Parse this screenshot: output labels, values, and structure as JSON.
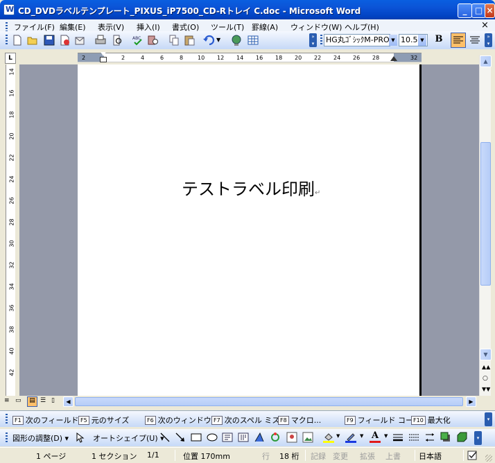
{
  "window": {
    "title": "CD_DVDラベルテンプレート_PIXUS_iP7500_CD-Rトレイ C.doc - Microsoft Word"
  },
  "menu": {
    "items": [
      "ファイル(F)",
      "編集(E)",
      "表示(V)",
      "挿入(I)",
      "書式(O)",
      "ツール(T)",
      "罫線(A)",
      "ウィンドウ(W)",
      "ヘルプ(H)"
    ],
    "close_doc": "×"
  },
  "formatting": {
    "font": "HG丸ｺﾞｼｯｸM-PRO",
    "size": "10.5",
    "bold": "B"
  },
  "ruler": {
    "h_ticks": [
      "2",
      "2",
      "4",
      "6",
      "8",
      "10",
      "12",
      "14",
      "16",
      "18",
      "20",
      "22",
      "24",
      "26",
      "28",
      "32"
    ],
    "v_ticks": [
      "14",
      "16",
      "18",
      "20",
      "22",
      "24",
      "26",
      "28",
      "30",
      "32",
      "34",
      "36",
      "38",
      "40",
      "42"
    ],
    "corner": "L"
  },
  "document": {
    "text": "テストラベル印刷",
    "para_mark": "↵"
  },
  "fkeys": [
    {
      "key": "F1",
      "label": "次のフィールド"
    },
    {
      "key": "F5",
      "label": "元のサイズ"
    },
    {
      "key": "F6",
      "label": "次のウィンドウ"
    },
    {
      "key": "F7",
      "label": "次のスペル ミス"
    },
    {
      "key": "F8",
      "label": "マクロ..."
    },
    {
      "key": "F9",
      "label": "フィールド コー..."
    },
    {
      "key": "F10",
      "label": "最大化"
    }
  ],
  "drawing": {
    "adjust": "図形の調整(D)",
    "autoshape": "オートシェイプ(U)"
  },
  "status": {
    "page": "1 ページ",
    "section": "1 セクション",
    "pages": "1/1",
    "position": "位置 170mm",
    "line": "行",
    "column": "18 桁",
    "rec": "記録",
    "trk": "変更",
    "ext": "拡張",
    "ovr": "上書",
    "language": "日本語"
  }
}
